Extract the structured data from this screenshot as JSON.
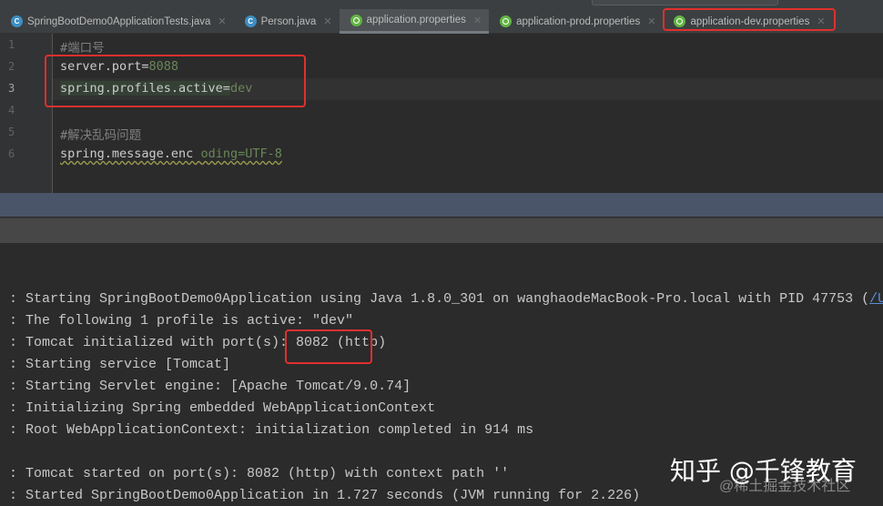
{
  "tabs": [
    {
      "label": "SpringBootDemo0ApplicationTests.java",
      "icon": "class-icon"
    },
    {
      "label": "Person.java",
      "icon": "class-icon"
    },
    {
      "label": "application.properties",
      "icon": "spring-icon",
      "active": true
    },
    {
      "label": "application-prod.properties",
      "icon": "spring-icon"
    },
    {
      "label": "application-dev.properties",
      "icon": "spring-icon",
      "highlighted": true
    }
  ],
  "editor": {
    "line_numbers": [
      "1",
      "2",
      "3",
      "4",
      "5",
      "6"
    ],
    "comment1": "#端口号",
    "line2_key": "server.port=",
    "line2_val": "8088",
    "line3_key": "spring.profiles.active=",
    "line3_val": "dev",
    "comment2": "#解决乱码问题",
    "line6_key": "spring.message.enc ",
    "line6_val": "oding=UTF-8"
  },
  "console": {
    "lines": [
      ": Starting SpringBootDemo0Application using Java 1.8.0_301 on wanghaodeMacBook-Pro.local with PID 47753 (",
      ": The following 1 profile is active: \"dev\"",
      ": Tomcat initialized with port(s): 8082 (http)",
      ": Starting service [Tomcat]",
      ": Starting Servlet engine: [Apache Tomcat/9.0.74]",
      ": Initializing Spring embedded WebApplicationContext",
      ": Root WebApplicationContext: initialization completed in 914 ms",
      ": Tomcat started on port(s): 8082 (http) with context path ''",
      ": Started SpringBootDemo0Application in 1.727 seconds (JVM running for 2.226)"
    ],
    "link_fragment": "/U"
  },
  "watermark": "知乎 @千锋教育",
  "watermark2": "@稀土掘金技术社区"
}
